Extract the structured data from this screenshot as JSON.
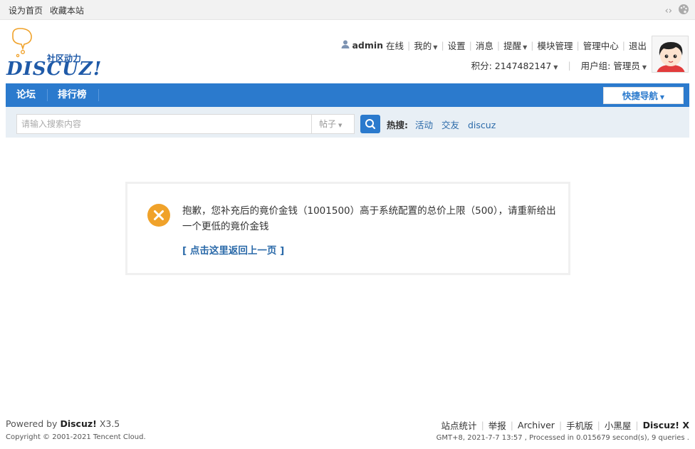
{
  "topbar": {
    "set_home": "设为首页",
    "bookmark": "收藏本站"
  },
  "logo": {
    "slogan": "社区动力",
    "brand": "DISCUZ!"
  },
  "user": {
    "name": "admin",
    "status": "在线",
    "menu": [
      "我的",
      "设置",
      "消息",
      "提醒",
      "模块管理",
      "管理中心",
      "退出"
    ],
    "points": "积分: 2147482147",
    "group": "用户组: 管理员"
  },
  "nav": {
    "items": [
      "论坛",
      "排行榜"
    ],
    "quick_nav": "快捷导航"
  },
  "search": {
    "placeholder": "请输入搜索内容",
    "type": "帖子",
    "hot_label": "热搜:",
    "hot_keywords": [
      "活动",
      "交友",
      "discuz"
    ]
  },
  "message": {
    "text": "抱歉，您补充后的竟价金钱（1001500）高于系统配置的总价上限（500），请重新给出一个更低的竟价金钱",
    "back_link": "[ 点击这里返回上一页 ]"
  },
  "footer": {
    "powered_by": "Powered by",
    "brand": "Discuz!",
    "version": "X3.5",
    "copyright": "Copyright © 2001-2021 Tencent Cloud.",
    "links": [
      "站点统计",
      "举报",
      "Archiver",
      "手机版",
      "小黑屋",
      "Discuz! X"
    ],
    "stats": "GMT+8, 2021-7-7 13:57 , Processed in 0.015679 second(s), 9 queries ."
  },
  "colors": {
    "nav_blue": "#2b7acd",
    "link_blue": "#2b6aa9",
    "error_orange": "#f0a22a",
    "search_bg": "#e8eff5"
  }
}
